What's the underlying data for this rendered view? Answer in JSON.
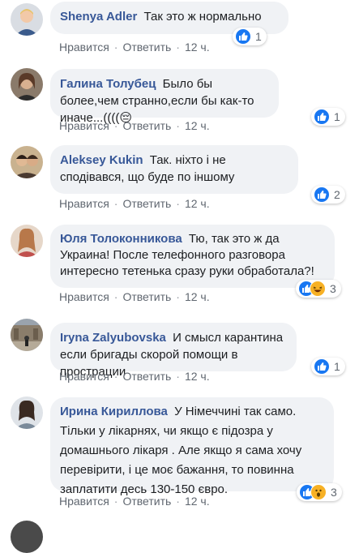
{
  "actions": {
    "like": "Нравится",
    "reply": "Ответить",
    "separator": "·"
  },
  "comments": [
    {
      "author": "Shenya Adler",
      "text": "Так это ж нормально",
      "time": "12 ч.",
      "reactions": [
        "like-icon"
      ],
      "reaction_count": "1"
    },
    {
      "author": "Галина Толубец",
      "text": "Было бы более,чем странно,если бы как-то иначе...((((😔",
      "time": "12 ч.",
      "reactions": [
        "like-icon"
      ],
      "reaction_count": "1"
    },
    {
      "author": "Aleksey Kukin",
      "text": "Так. ніхто і не сподівався, що буде по іншому",
      "time": "12 ч.",
      "reactions": [
        "like-icon"
      ],
      "reaction_count": "2"
    },
    {
      "author": "Юля Толоконникова",
      "text": "Тю, так это ж да Украина! После телефонного разговора интересно тетенька сразу руки обработала?!",
      "time": "12 ч.",
      "reactions": [
        "like-icon",
        "laughing-face-icon"
      ],
      "reaction_count": "3"
    },
    {
      "author": "Iryna Zalyubovska",
      "text": "И смысл карантина если бригады скорой помощи в прострации",
      "time": "12 ч.",
      "reactions": [
        "like-icon"
      ],
      "reaction_count": "1"
    },
    {
      "author": "Ирина Кириллова",
      "text": "У Німеччині так само. Тільки у лікарнях, чи якщо є підозра у домашнього лікаря . Але якщо я сама хочу перевірити, і це моє бажання, то повинна заплатити десь 130-150 євро.",
      "time": "12 ч.",
      "reactions": [
        "like-icon",
        "surprised-face-icon"
      ],
      "reaction_count": "3"
    }
  ],
  "colors": {
    "author": "#385898",
    "bubble": "#f0f2f5",
    "like": "#1877f2",
    "emoji": "#f7b125"
  }
}
